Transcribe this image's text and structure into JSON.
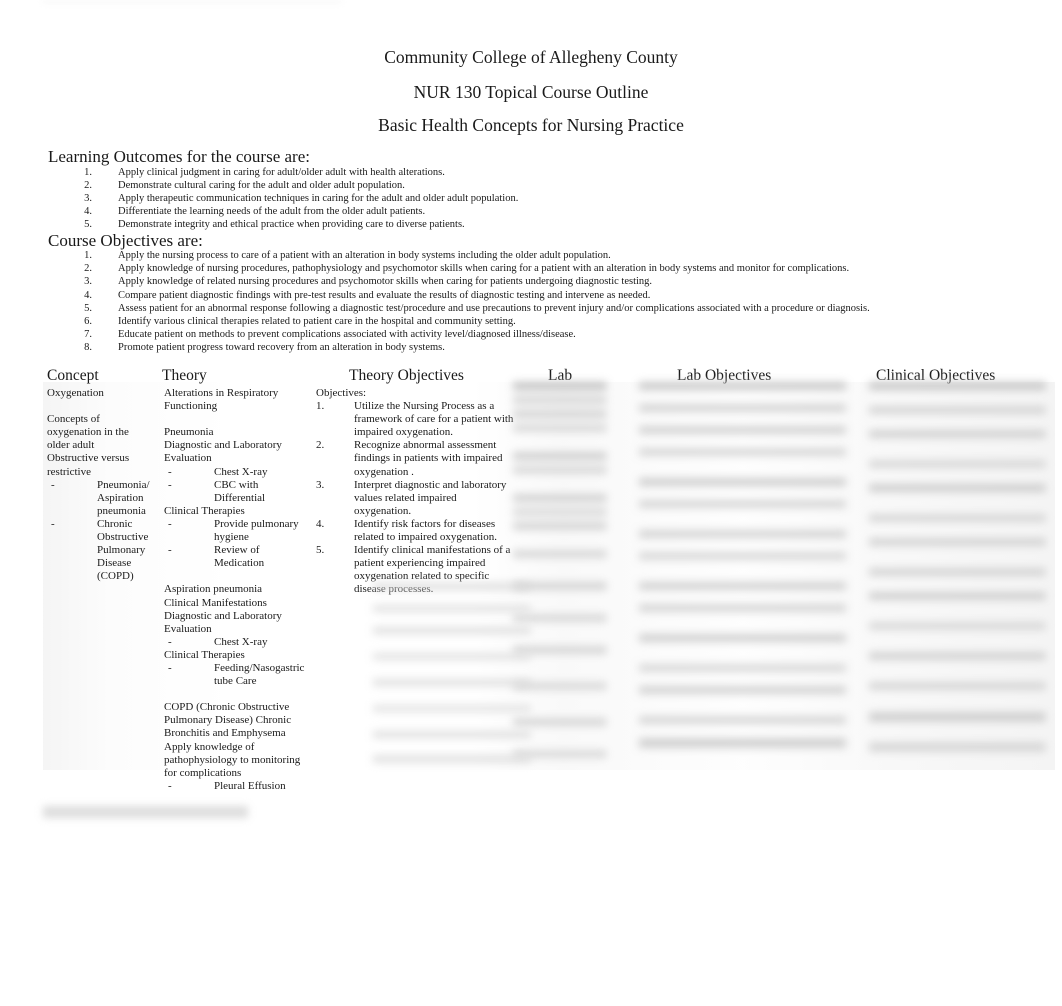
{
  "document": {
    "titles": [
      "Community College of Allegheny County",
      "NUR 130 Topical Course Outline",
      "Basic Health Concepts for Nursing Practice"
    ],
    "learning_outcomes": {
      "heading": "Learning Outcomes for the course are:",
      "items": [
        {
          "num": "1.",
          "text": "Apply clinical judgment in caring for adult/older adult with health alterations."
        },
        {
          "num": "2.",
          "text": "Demonstrate cultural caring for the adult and older adult population."
        },
        {
          "num": "3.",
          "text": "Apply therapeutic communication techniques in caring for the adult and older adult population."
        },
        {
          "num": "4.",
          "text": "Differentiate the learning needs of the adult from the older adult patients."
        },
        {
          "num": "5.",
          "text": "Demonstrate integrity and ethical practice when providing care to diverse patients."
        }
      ]
    },
    "course_objectives": {
      "heading": "Course Objectives are:",
      "items": [
        {
          "num": "1.",
          "text": "Apply the nursing process to care of a patient with an alteration in body systems including the older adult population."
        },
        {
          "num": "2.",
          "text": "Apply knowledge of nursing procedures, pathophysiology and psychomotor skills when caring for a patient with an alteration in body systems and monitor for complications."
        },
        {
          "num": "3.",
          "text": "Apply knowledge of related nursing procedures and psychomotor skills when caring for patients undergoing diagnostic testing."
        },
        {
          "num": "4.",
          "text": "Compare patient diagnostic findings with pre-test results and evaluate the results of diagnostic testing and intervene as needed."
        },
        {
          "num": "5.",
          "text": "Assess patient for an abnormal response following a diagnostic test/procedure and use precautions to prevent injury and/or complications associated with a procedure or diagnosis."
        },
        {
          "num": "6.",
          "text": "Identify various clinical therapies related to patient care in the hospital and community setting."
        },
        {
          "num": "7.",
          "text": "Educate patient on methods to prevent complications associated with activity level/diagnosed illness/disease."
        },
        {
          "num": "8.",
          "text": "Promote patient progress toward recovery from an alteration in body systems."
        }
      ]
    },
    "outline_table": {
      "headers": [
        "Concept",
        "Theory",
        "Theory Objectives",
        "Lab",
        "Lab Objectives",
        "Clinical Objectives"
      ],
      "concept_cell": {
        "lines": [
          {
            "type": "text",
            "text": "Oxygenation"
          },
          {
            "type": "blank"
          },
          {
            "type": "text",
            "text": "Concepts of"
          },
          {
            "type": "text",
            "text": "oxygenation in the"
          },
          {
            "type": "text",
            "text": "older adult"
          },
          {
            "type": "text",
            "text": "Obstructive versus"
          },
          {
            "type": "text",
            "text": "restrictive"
          },
          {
            "type": "dash",
            "text": "Pneumonia/"
          },
          {
            "type": "cont",
            "text": "Aspiration"
          },
          {
            "type": "cont",
            "text": "pneumonia"
          },
          {
            "type": "dash",
            "text": "Chronic"
          },
          {
            "type": "cont",
            "text": "Obstructive"
          },
          {
            "type": "cont",
            "text": "Pulmonary"
          },
          {
            "type": "cont",
            "text": "Disease (COPD)"
          }
        ]
      },
      "theory_cell": {
        "lines": [
          {
            "type": "text",
            "text": "Alterations in Respiratory"
          },
          {
            "type": "text",
            "text": "Functioning"
          },
          {
            "type": "blank"
          },
          {
            "type": "text",
            "text": "Pneumonia"
          },
          {
            "type": "text",
            "text": "Diagnostic and Laboratory"
          },
          {
            "type": "text",
            "text": "Evaluation"
          },
          {
            "type": "dash",
            "text": "Chest X-ray"
          },
          {
            "type": "dash",
            "text": "CBC with Differential"
          },
          {
            "type": "text",
            "text": "Clinical Therapies"
          },
          {
            "type": "dash",
            "text": "Provide pulmonary"
          },
          {
            "type": "cont",
            "text": "hygiene"
          },
          {
            "type": "dash",
            "text": "Review of Medication"
          },
          {
            "type": "blank"
          },
          {
            "type": "text",
            "text": "Aspiration pneumonia"
          },
          {
            "type": "text",
            "text": "Clinical Manifestations"
          },
          {
            "type": "text",
            "text": "Diagnostic and Laboratory"
          },
          {
            "type": "text",
            "text": "Evaluation"
          },
          {
            "type": "dash",
            "text": "Chest X-ray"
          },
          {
            "type": "text",
            "text": "Clinical Therapies"
          },
          {
            "type": "dash",
            "text": "Feeding/Nasogastric"
          },
          {
            "type": "cont",
            "text": "tube Care"
          },
          {
            "type": "blank"
          },
          {
            "type": "text",
            "text": "COPD (Chronic Obstructive"
          },
          {
            "type": "text",
            "text": "Pulmonary Disease) Chronic"
          },
          {
            "type": "text",
            "text": "Bronchitis and Emphysema"
          },
          {
            "type": "text",
            "text": "Apply knowledge of"
          },
          {
            "type": "text",
            "text": "pathophysiology to monitoring"
          },
          {
            "type": "text",
            "text": "for complications"
          },
          {
            "type": "dash",
            "text": "Pleural Effusion"
          }
        ]
      },
      "theory_objectives_cell": {
        "label": "Objectives:",
        "items": [
          {
            "num": "1.",
            "lines": [
              "Utilize the Nursing Process as a",
              "framework of care for a patient with",
              "impaired oxygenation."
            ]
          },
          {
            "num": "2.",
            "lines": [
              "Recognize abnormal assessment",
              "findings in patients with impaired",
              "oxygenation ."
            ]
          },
          {
            "num": "3.",
            "lines": [
              "Interpret diagnostic and laboratory",
              "values related impaired  oxygenation."
            ]
          },
          {
            "num": "4.",
            "lines": [
              "Identify risk factors for diseases",
              "related to impaired  oxygenation."
            ]
          },
          {
            "num": "5.",
            "lines": [
              "Identify clinical manifestations of a",
              "patient experiencing impaired",
              "oxygenation related to specific",
              "disease processes."
            ]
          }
        ]
      }
    }
  }
}
